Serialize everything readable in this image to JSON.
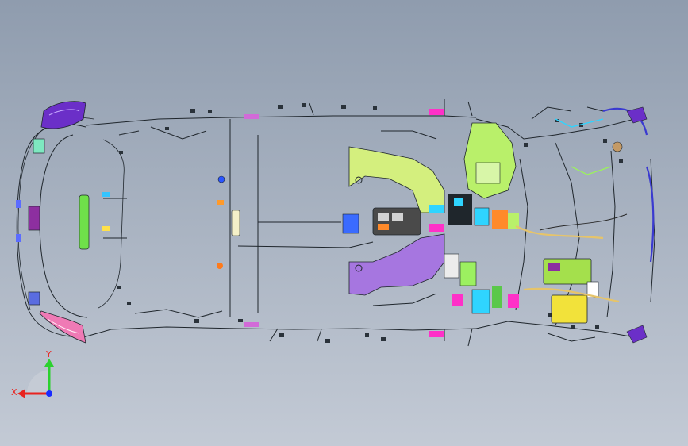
{
  "view": {
    "background_top": "#8f9cae",
    "background_bottom": "#c3cad5"
  },
  "harness": {
    "wire_color": "#1f262c",
    "connector_colors": [
      "#ff30c8",
      "#9b3df0",
      "#2fd4ff",
      "#7dff3a",
      "#ffe14a",
      "#ff7a1a",
      "#3a5bff",
      "#18b8a0"
    ],
    "bracket_lime": "#d4ef7e",
    "bracket_purple": "#a676e0",
    "module_green": "#b9f06a",
    "module_lime": "#a4e04c",
    "module_yellow": "#f2e23a"
  },
  "triad": {
    "x_label": "X",
    "y_label": "Y",
    "x_color": "#e8231f",
    "y_color": "#2bd12e",
    "z_color": "#1a2bff"
  }
}
